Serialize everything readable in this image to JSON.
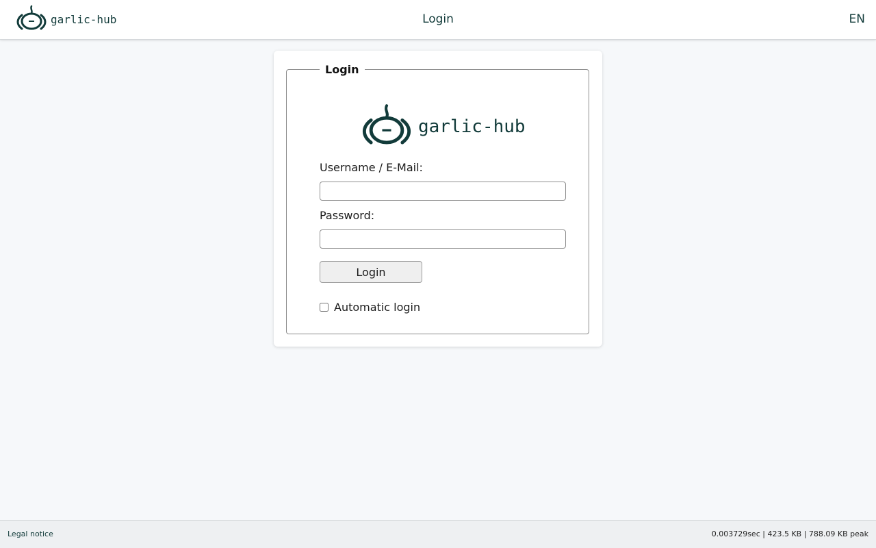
{
  "header": {
    "brand_text": "garlic-hub",
    "title": "Login",
    "language": "EN"
  },
  "login_form": {
    "legend": "Login",
    "logo_text": "garlic-hub",
    "username_label": "Username / E-Mail:",
    "username_value": "",
    "password_label": "Password:",
    "password_value": "",
    "submit_label": "Login",
    "auto_login_label": "Automatic login",
    "auto_login_checked": false
  },
  "footer": {
    "legal_notice": "Legal notice",
    "stats": "0.003729sec | 423.5 KB | 788.09 KB peak"
  },
  "colors": {
    "brand": "#123b3a",
    "background": "#f6f8fa"
  },
  "icons": {
    "logo": "garlic-logo-icon"
  }
}
